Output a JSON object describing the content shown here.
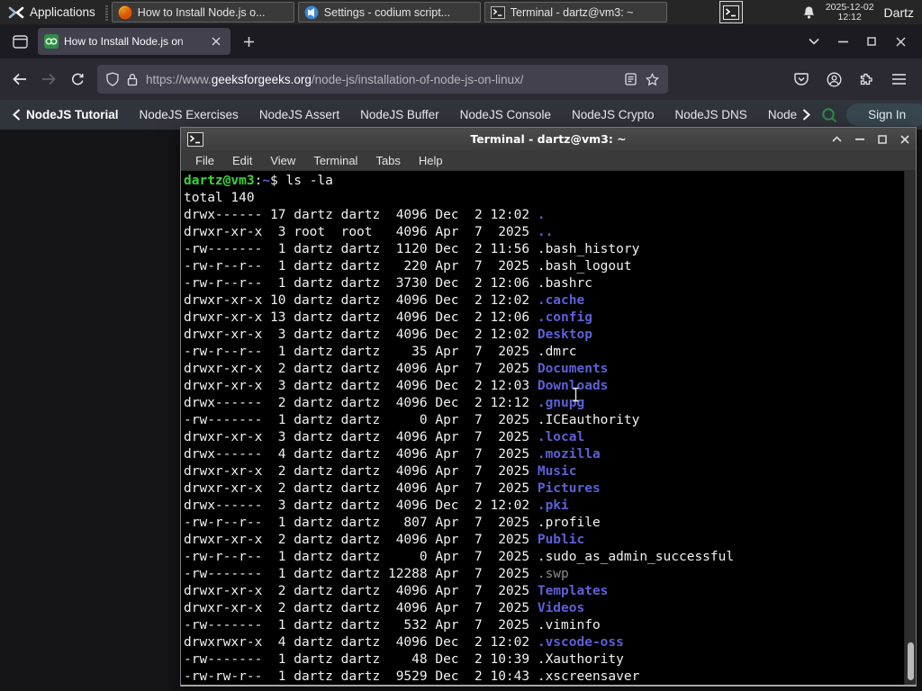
{
  "panel": {
    "applications_label": "Applications",
    "tasks": [
      {
        "id": "firefox",
        "icon": "firefox",
        "label": "How to Install Node.js o..."
      },
      {
        "id": "vscodium",
        "icon": "vscodium",
        "label": "Settings - codium script..."
      },
      {
        "id": "terminal",
        "icon": "terminal",
        "label": "Terminal - dartz@vm3: ~"
      }
    ],
    "clock_date": "2025-12-02",
    "clock_time": "12:12",
    "user": "Dartz"
  },
  "browser": {
    "tab_title": "How to Install Node.js on",
    "url_prefix": "https://www.",
    "url_domain": "geeksforgeeks.org",
    "url_path": "/node-js/installation-of-node-js-on-linux/",
    "site_nav_back": "NodeJS Tutorial",
    "site_nav_items": [
      "NodeJS Exercises",
      "NodeJS Assert",
      "NodeJS Buffer",
      "NodeJS Console",
      "NodeJS Crypto",
      "NodeJS DNS"
    ],
    "site_nav_truncated": "Node",
    "signin_label": "Sign In",
    "accent_green": "#2f8d46"
  },
  "terminal": {
    "title": "Terminal - dartz@vm3: ~",
    "menu": [
      "File",
      "Edit",
      "View",
      "Terminal",
      "Tabs",
      "Help"
    ],
    "prompt": {
      "user_host": "dartz@vm3",
      "colon": ":",
      "cwd": "~",
      "rest": "$ ls -la"
    },
    "lines": [
      {
        "pre": "total 140",
        "name": "",
        "type": "plain"
      },
      {
        "pre": "drwx------ 17 dartz dartz  4096 Dec  2 12:02 ",
        "name": ".",
        "type": "dir"
      },
      {
        "pre": "drwxr-xr-x  3 root  root   4096 Apr  7  2025 ",
        "name": "..",
        "type": "dir"
      },
      {
        "pre": "-rw-------  1 dartz dartz  1120 Dec  2 11:56 ",
        "name": ".bash_history",
        "type": "file"
      },
      {
        "pre": "-rw-r--r--  1 dartz dartz   220 Apr  7  2025 ",
        "name": ".bash_logout",
        "type": "file"
      },
      {
        "pre": "-rw-r--r--  1 dartz dartz  3730 Dec  2 12:06 ",
        "name": ".bashrc",
        "type": "file"
      },
      {
        "pre": "drwxr-xr-x 10 dartz dartz  4096 Dec  2 12:02 ",
        "name": ".cache",
        "type": "dir"
      },
      {
        "pre": "drwxr-xr-x 13 dartz dartz  4096 Dec  2 12:06 ",
        "name": ".config",
        "type": "dir"
      },
      {
        "pre": "drwxr-xr-x  3 dartz dartz  4096 Dec  2 12:02 ",
        "name": "Desktop",
        "type": "dir"
      },
      {
        "pre": "-rw-r--r--  1 dartz dartz    35 Apr  7  2025 ",
        "name": ".dmrc",
        "type": "file"
      },
      {
        "pre": "drwxr-xr-x  2 dartz dartz  4096 Apr  7  2025 ",
        "name": "Documents",
        "type": "dir"
      },
      {
        "pre": "drwxr-xr-x  3 dartz dartz  4096 Dec  2 12:03 ",
        "name": "Downloads",
        "type": "dir"
      },
      {
        "pre": "drwx------  2 dartz dartz  4096 Dec  2 12:12 ",
        "name": ".gnupg",
        "type": "dir"
      },
      {
        "pre": "-rw-------  1 dartz dartz     0 Apr  7  2025 ",
        "name": ".ICEauthority",
        "type": "file"
      },
      {
        "pre": "drwxr-xr-x  3 dartz dartz  4096 Apr  7  2025 ",
        "name": ".local",
        "type": "dir"
      },
      {
        "pre": "drwx------  4 dartz dartz  4096 Apr  7  2025 ",
        "name": ".mozilla",
        "type": "dir"
      },
      {
        "pre": "drwxr-xr-x  2 dartz dartz  4096 Apr  7  2025 ",
        "name": "Music",
        "type": "dir"
      },
      {
        "pre": "drwxr-xr-x  2 dartz dartz  4096 Apr  7  2025 ",
        "name": "Pictures",
        "type": "dir"
      },
      {
        "pre": "drwx------  3 dartz dartz  4096 Dec  2 12:02 ",
        "name": ".pki",
        "type": "dir"
      },
      {
        "pre": "-rw-r--r--  1 dartz dartz   807 Apr  7  2025 ",
        "name": ".profile",
        "type": "file"
      },
      {
        "pre": "drwxr-xr-x  2 dartz dartz  4096 Apr  7  2025 ",
        "name": "Public",
        "type": "dir"
      },
      {
        "pre": "-rw-r--r--  1 dartz dartz     0 Apr  7  2025 ",
        "name": ".sudo_as_admin_successful",
        "type": "file"
      },
      {
        "pre": "-rw-------  1 dartz dartz 12288 Apr  7  2025 ",
        "name": ".swp",
        "type": "dim"
      },
      {
        "pre": "drwxr-xr-x  2 dartz dartz  4096 Apr  7  2025 ",
        "name": "Templates",
        "type": "dir"
      },
      {
        "pre": "drwxr-xr-x  2 dartz dartz  4096 Apr  7  2025 ",
        "name": "Videos",
        "type": "dir"
      },
      {
        "pre": "-rw-------  1 dartz dartz   532 Apr  7  2025 ",
        "name": ".viminfo",
        "type": "file"
      },
      {
        "pre": "drwxrwxr-x  4 dartz dartz  4096 Dec  2 12:02 ",
        "name": ".vscode-oss",
        "type": "dir"
      },
      {
        "pre": "-rw-------  1 dartz dartz    48 Dec  2 10:39 ",
        "name": ".Xauthority",
        "type": "file"
      },
      {
        "pre": "-rw-rw-r--  1 dartz dartz  9529 Dec  2 10:43 ",
        "name": ".xscreensaver",
        "type": "file"
      }
    ]
  }
}
